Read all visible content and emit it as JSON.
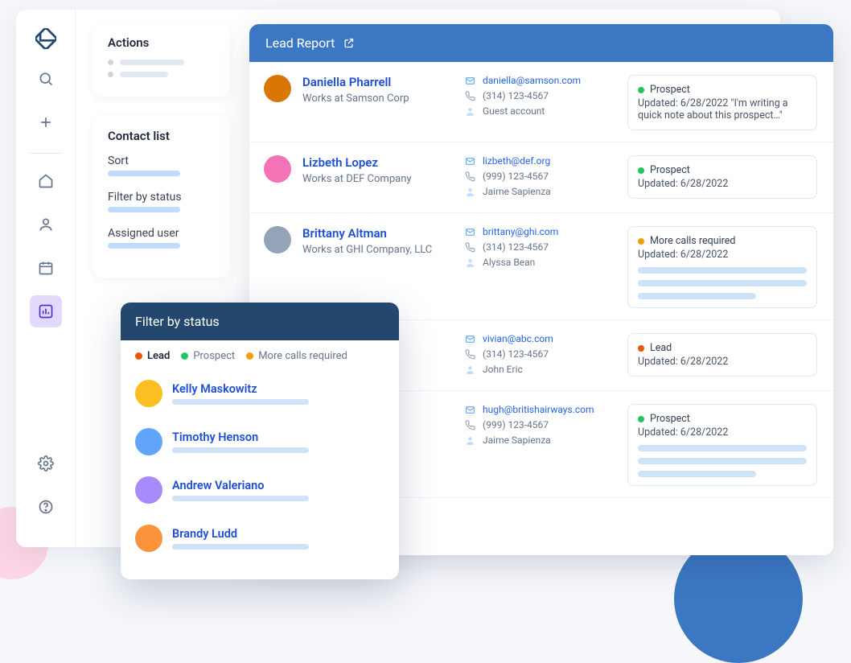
{
  "sidebar": {
    "icons": [
      "logo",
      "search",
      "add",
      "home",
      "user",
      "calendar",
      "reports",
      "settings",
      "help"
    ]
  },
  "actions": {
    "title": "Actions"
  },
  "contact_list": {
    "title": "Contact list",
    "filters": {
      "sort": "Sort",
      "by_status": "Filter by status",
      "assigned_user": "Assigned user"
    }
  },
  "lead_report": {
    "title": "Lead Report",
    "rows": [
      {
        "name": "Daniella Pharrell",
        "works": "Works at Samson Corp",
        "email": "daniella@samson.com",
        "phone": "(314) 123-4567",
        "account": "Guest account",
        "status_label": "Prospect",
        "status_color": "green",
        "updated": "Updated: 6/28/2022",
        "note": "\"I'm writing a quick note about this prospect…\"",
        "placeholders": 0
      },
      {
        "name": "Lizbeth Lopez",
        "works": "Works at DEF Company",
        "email": "lizbeth@def.org",
        "phone": "(999) 123-4567",
        "account": "Jaime Sapienza",
        "status_label": "Prospect",
        "status_color": "green",
        "updated": "Updated: 6/28/2022",
        "note": "",
        "placeholders": 0
      },
      {
        "name": "Brittany Altman",
        "works": "Works at GHI Company, LLC",
        "email": "brittany@ghi.com",
        "phone": "(314) 123-4567",
        "account": "Alyssa Bean",
        "status_label": "More calls required",
        "status_color": "amber",
        "updated": "Updated: 6/28/2022",
        "note": "",
        "placeholders": 3
      },
      {
        "name": "",
        "works": "",
        "email": "vivian@abc.com",
        "phone": "(314) 123-4567",
        "account": "John Eric",
        "status_label": "Lead",
        "status_color": "orange-red",
        "updated": "Updated: 6/28/2022",
        "note": "",
        "placeholders": 0
      },
      {
        "name": "",
        "works": "",
        "email": "hugh@britishairways.com",
        "phone": "(999) 123-4567",
        "account": "Jaime Sapienza",
        "status_label": "Prospect",
        "status_color": "green",
        "updated": "Updated: 6/28/2022",
        "note": "",
        "placeholders": 3
      }
    ]
  },
  "filter_popup": {
    "title": "Filter by status",
    "legend": {
      "lead": "Lead",
      "prospect": "Prospect",
      "calls": "More calls required"
    },
    "people": [
      {
        "name": "Kelly Maskowitz"
      },
      {
        "name": "Timothy Henson"
      },
      {
        "name": "Andrew Valeriano"
      },
      {
        "name": "Brandy Ludd"
      }
    ]
  },
  "colors": {
    "primary": "#3b77c2",
    "popup_header": "#24476e",
    "link": "#1d4ed8"
  },
  "avatar_colors": [
    "#d97706",
    "#f472b6",
    "#94a3b8",
    "#fbbf24",
    "#60a5fa",
    "#a78bfa",
    "#fb923c"
  ]
}
